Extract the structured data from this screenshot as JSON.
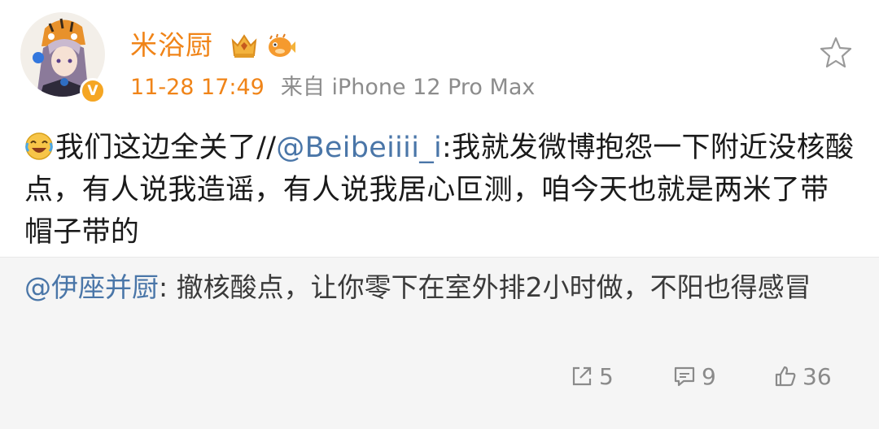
{
  "post": {
    "author": "米浴厨",
    "time": "11-28 17:49",
    "source": "来自 iPhone 12 Pro Max",
    "verified_mark": "V",
    "content": {
      "emoji": "laugh-cry-emoji",
      "text_before": "我们这边全关了//",
      "mention": "@Beibeiiii_i",
      "text_after": ":我就发微博抱怨一下附近没核酸点，有人说我造谣，有人说我居心叵测，咱今天也就是两米了带帽子带的"
    },
    "repost": {
      "mention": "@伊座并厨",
      "text": ": 撤核酸点，让你零下在室外排2小时做，不阳也得感冒"
    },
    "stats": {
      "shares": "5",
      "comments": "9",
      "likes": "36"
    }
  },
  "colors": {
    "accent": "#f08418",
    "mention": "#4a76a8",
    "repost_bg": "#f5f5f5",
    "stat_gray": "#8a8a8a"
  },
  "icons": [
    "avatar",
    "vip-crown-badge",
    "pufferfish-badge",
    "star-icon",
    "share-icon",
    "comment-icon",
    "like-icon"
  ]
}
